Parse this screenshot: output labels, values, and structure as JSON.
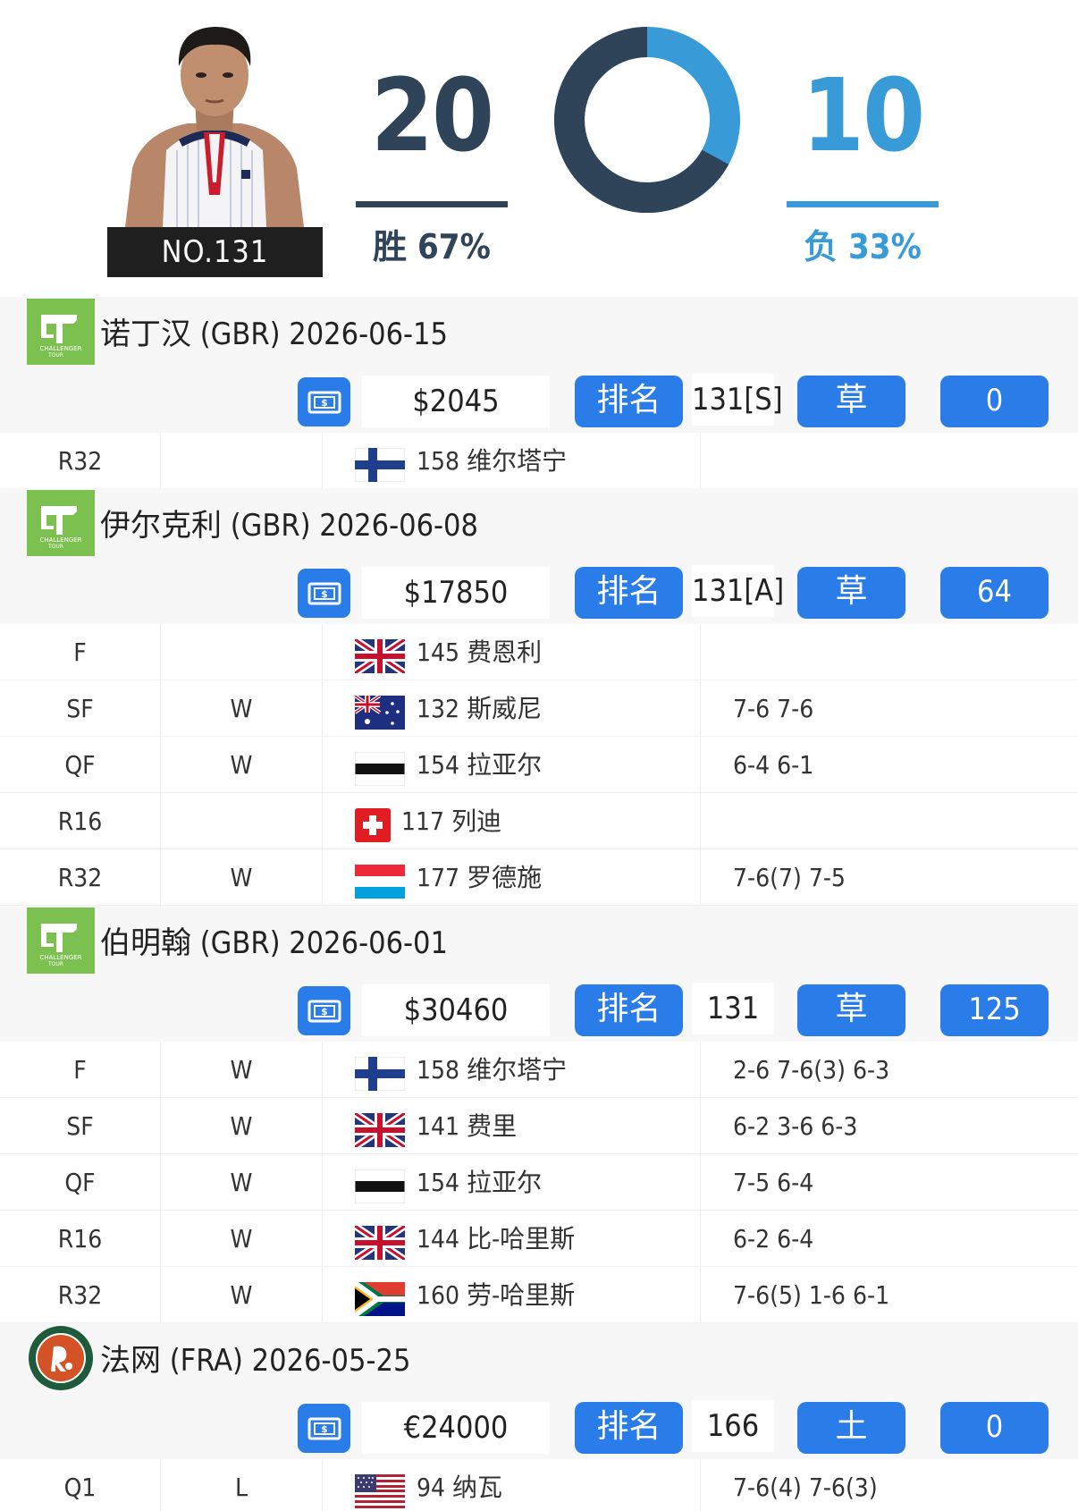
{
  "player": {
    "rank_label": "NO.131",
    "wins": "20",
    "wins_label": "胜 67%",
    "losses": "10",
    "losses_label": "负 33%",
    "win_fraction": 0.67,
    "colors": {
      "wins": "#2f4359",
      "losses": "#389ad6"
    }
  },
  "tournaments": [
    {
      "title": "诺丁汉 (GBR) 2026-06-15",
      "logo": "challenger-tour-logo",
      "prize": "$2045",
      "rank_button": "排名",
      "rank": "131[S]",
      "surface": "草",
      "points": "0",
      "matches": [
        {
          "round": "R32",
          "result": "",
          "flag": "fin",
          "opponent": "158 维尔塔宁",
          "score": ""
        }
      ]
    },
    {
      "title": "伊尔克利 (GBR) 2026-06-08",
      "logo": "challenger-tour-logo",
      "prize": "$17850",
      "rank_button": "排名",
      "rank": "131[A]",
      "surface": "草",
      "points": "64",
      "matches": [
        {
          "round": "F",
          "result": "",
          "flag": "gbr",
          "opponent": "145 费恩利",
          "score": ""
        },
        {
          "round": "SF",
          "result": "W",
          "flag": "aus",
          "opponent": "132 斯威尼",
          "score": "7-6 7-6"
        },
        {
          "round": "QF",
          "result": "W",
          "flag": "est",
          "opponent": "154 拉亚尔",
          "score": "6-4 6-1"
        },
        {
          "round": "R16",
          "result": "",
          "flag": "sui",
          "opponent": "117 列迪",
          "score": ""
        },
        {
          "round": "R32",
          "result": "W",
          "flag": "lux",
          "opponent": "177 罗德施",
          "score": "7-6(7) 7-5"
        }
      ]
    },
    {
      "title": "伯明翰 (GBR) 2026-06-01",
      "logo": "challenger-tour-logo",
      "prize": "$30460",
      "rank_button": "排名",
      "rank": "131",
      "surface": "草",
      "points": "125",
      "matches": [
        {
          "round": "F",
          "result": "W",
          "flag": "fin",
          "opponent": "158 维尔塔宁",
          "score": "2-6 7-6(3) 6-3"
        },
        {
          "round": "SF",
          "result": "W",
          "flag": "gbr",
          "opponent": "141 费里",
          "score": "6-2 3-6 6-3"
        },
        {
          "round": "QF",
          "result": "W",
          "flag": "est",
          "opponent": "154 拉亚尔",
          "score": "7-5 6-4"
        },
        {
          "round": "R16",
          "result": "W",
          "flag": "gbr",
          "opponent": "144 比-哈里斯",
          "score": "6-2 6-4"
        },
        {
          "round": "R32",
          "result": "W",
          "flag": "rsa",
          "opponent": "160 劳-哈里斯",
          "score": "7-6(5) 1-6 6-1"
        }
      ]
    },
    {
      "title": "法网 (FRA) 2026-05-25",
      "logo": "roland-garros-logo",
      "prize": "€24000",
      "rank_button": "排名",
      "rank": "166",
      "surface": "土",
      "points": "0",
      "matches": [
        {
          "round": "Q1",
          "result": "L",
          "flag": "usa",
          "opponent": "94 纳瓦",
          "score": "7-6(4) 7-6(3)"
        }
      ]
    }
  ]
}
